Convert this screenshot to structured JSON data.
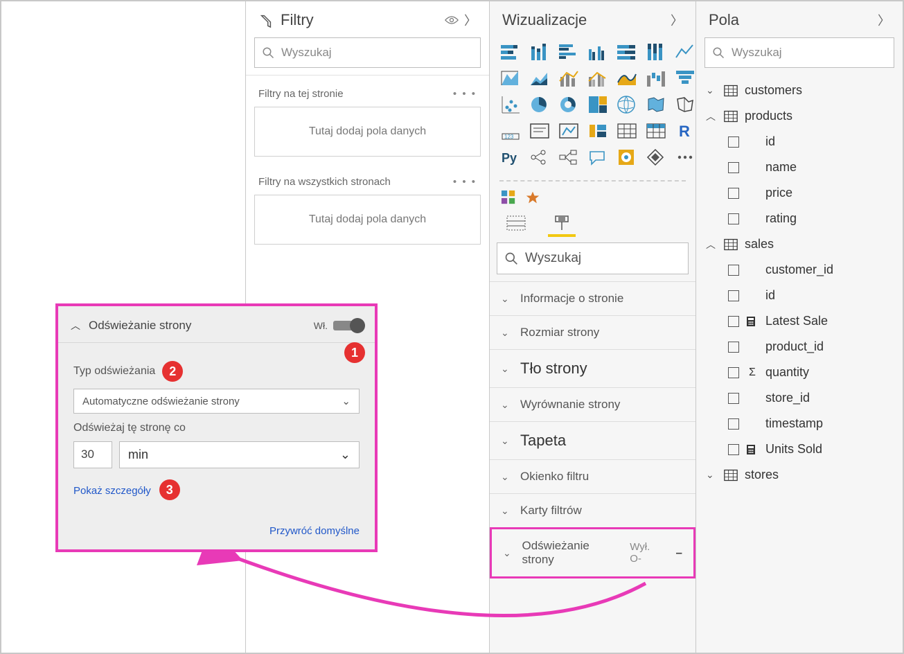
{
  "filters": {
    "title": "Filtry",
    "search_placeholder": "Wyszukaj",
    "section_page": "Filtry na tej stronie",
    "section_all": "Filtry na wszystkich stronach",
    "dropzone_text": "Tutaj dodaj pola danych"
  },
  "viz": {
    "title": "Wizualizacje",
    "search_placeholder": "Wyszukaj",
    "format_sections": {
      "info": "Informacje o stronie",
      "size": "Rozmiar strony",
      "background": "Tło strony",
      "align": "Wyrównanie strony",
      "wallpaper": "Tapeta",
      "filterpane": "Okienko filtru",
      "filtercards": "Karty filtrów",
      "refresh": "Odświeżanie strony",
      "refresh_state": "Wył. O-"
    }
  },
  "popup": {
    "title": "Odświeżanie strony",
    "on_label": "Wł.",
    "type_label": "Typ odświeżania",
    "type_value": "Automatyczne odświeżanie strony",
    "interval_label": "Odświeżaj tę stronę co",
    "interval_value": "30",
    "interval_unit": "min",
    "show_details": "Pokaż szczegóły",
    "restore": "Przywróć domyślne",
    "badges": {
      "b1": "1",
      "b2": "2",
      "b3": "3"
    }
  },
  "fields": {
    "title": "Pola",
    "search_placeholder": "Wyszukaj",
    "tables": [
      {
        "name": "customers",
        "expanded": false,
        "children": []
      },
      {
        "name": "products",
        "expanded": true,
        "children": [
          {
            "name": "id"
          },
          {
            "name": "name"
          },
          {
            "name": "price"
          },
          {
            "name": "rating"
          }
        ]
      },
      {
        "name": "sales",
        "expanded": true,
        "children": [
          {
            "name": "customer_id"
          },
          {
            "name": "id"
          },
          {
            "name": "Latest Sale",
            "sym": "calc"
          },
          {
            "name": "product_id"
          },
          {
            "name": "quantity",
            "sym": "sigma"
          },
          {
            "name": "store_id"
          },
          {
            "name": "timestamp"
          },
          {
            "name": "Units Sold",
            "sym": "calc"
          }
        ]
      },
      {
        "name": "stores",
        "expanded": false,
        "children": []
      }
    ]
  }
}
